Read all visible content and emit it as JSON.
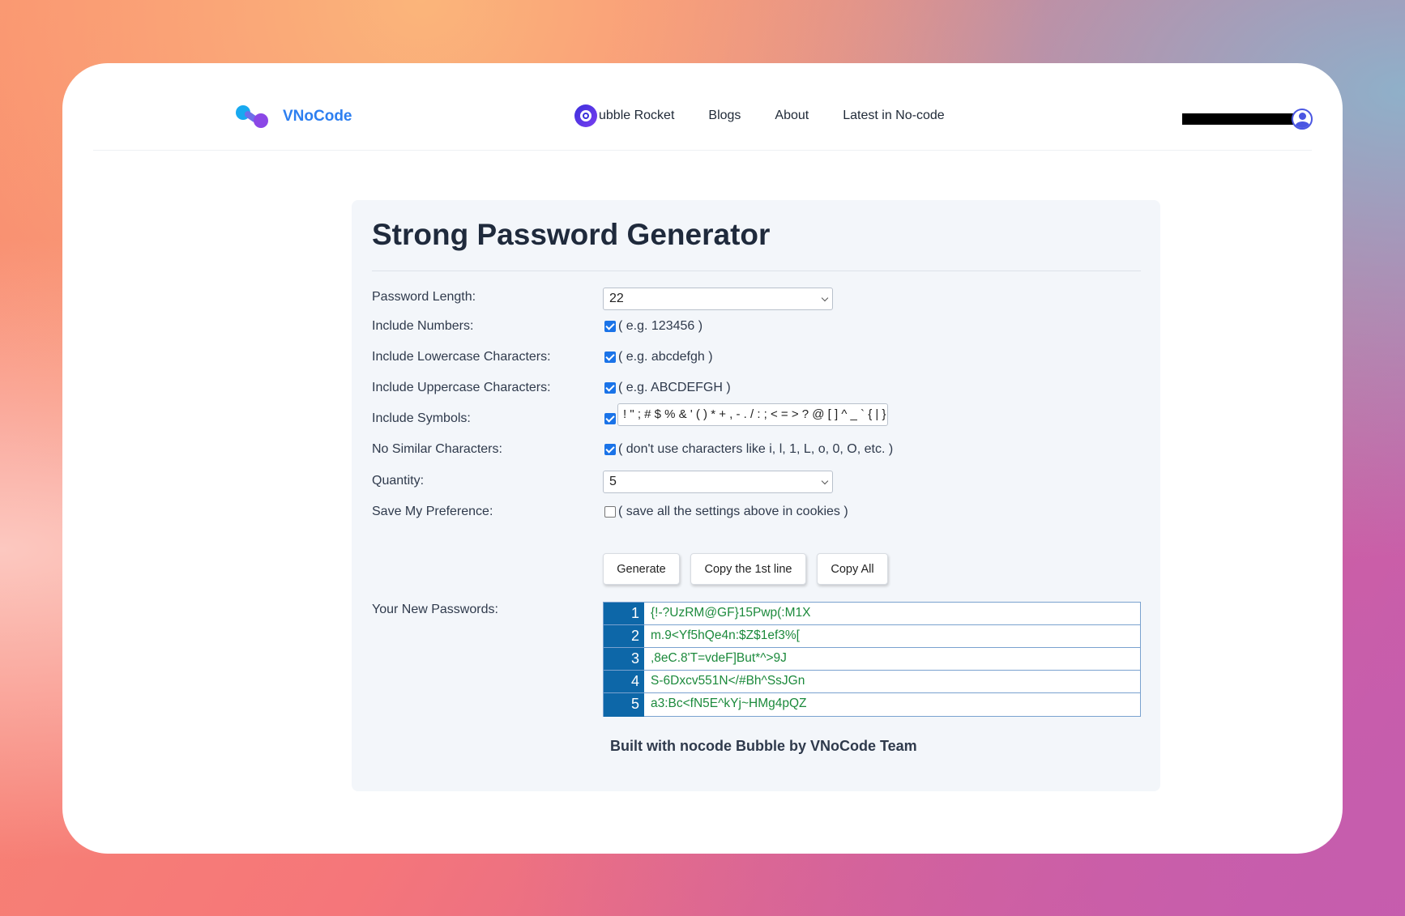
{
  "nav": {
    "logo_text": "VNoCode",
    "items": [
      {
        "label": "ubble Rocket"
      },
      {
        "label": "Blogs"
      },
      {
        "label": "About"
      },
      {
        "label": "Latest in No-code"
      }
    ]
  },
  "main": {
    "title": "Strong Password Generator",
    "fields": {
      "length": {
        "label": "Password Length:",
        "value": "22"
      },
      "numbers": {
        "label": "Include Numbers:",
        "checked": true,
        "hint": "( e.g. 123456 )"
      },
      "lowercase": {
        "label": "Include Lowercase Characters:",
        "checked": true,
        "hint": "( e.g. abcdefgh )"
      },
      "uppercase": {
        "label": "Include Uppercase Characters:",
        "checked": true,
        "hint": "( e.g. ABCDEFGH )"
      },
      "symbols": {
        "label": "Include Symbols:",
        "checked": true,
        "value": "! \" ; # $ % & ' ( ) * + , - . / : ; < = > ? @ [ ] ^ _ ` { | }"
      },
      "similar": {
        "label": "No Similar Characters:",
        "checked": true,
        "hint": "( don't use characters like i, l, 1, L, o, 0, O, etc. )"
      },
      "quantity": {
        "label": "Quantity:",
        "value": "5"
      },
      "save": {
        "label": "Save My Preference:",
        "checked": false,
        "hint": "( save all the settings above in cookies )"
      }
    },
    "buttons": {
      "generate": "Generate",
      "copy_first": "Copy the 1st line",
      "copy_all": "Copy All"
    },
    "passwords_label": "Your New Passwords:",
    "passwords": [
      {
        "num": "1",
        "value": "{!-?UzRM@GF}15Pwp(:M1X"
      },
      {
        "num": "2",
        "value": "m.9<Yf5hQe4n:$Z$1ef3%["
      },
      {
        "num": "3",
        "value": ",8eC.8'T=vdeF]But*^>9J"
      },
      {
        "num": "4",
        "value": "S-6Dxcv551N</#Bh^SsJGn"
      },
      {
        "num": "5",
        "value": "a3:Bc<fN5E^kYj~HMg4pQZ"
      }
    ],
    "footer": "Built with nocode Bubble by VNoCode Team"
  },
  "colors": {
    "brand": "#2d7ff0",
    "table_number_bg": "#0d67a8",
    "password_text": "#1c8a3c",
    "checkbox": "#1a73e8"
  }
}
